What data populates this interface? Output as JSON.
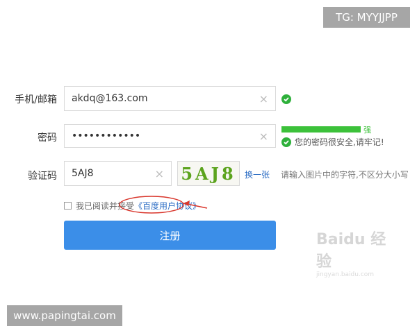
{
  "watermarks": {
    "top_right": "TG: MYYJJPP",
    "bottom_left": "www.papingtai.com",
    "baidu_logo": "Baidu 经验",
    "baidu_sub": "jingyan.baidu.com"
  },
  "form": {
    "email": {
      "label": "手机/邮箱",
      "value": "akdq@163.com",
      "clear_icon": "×"
    },
    "password": {
      "label": "密码",
      "value": "••••••••••••",
      "clear_icon": "×",
      "strength_label": "强",
      "message": "您的密码很安全,请牢记!"
    },
    "captcha": {
      "label": "验证码",
      "value": "5AJ8",
      "clear_icon": "×",
      "image_text": "5AJ8",
      "refresh_label": "换一张",
      "hint": "请输入图片中的字符,不区分大小写"
    },
    "agreement": {
      "prefix": "我已阅读并接受",
      "link": "《百度用户协议》"
    },
    "submit_label": "注册"
  },
  "colors": {
    "accent": "#3b8ee8",
    "success": "#2eb03b",
    "link": "#2b6cc4",
    "annotation": "#d9362c"
  },
  "icons": {
    "ok": "checkmark-circle-icon",
    "clear": "clear-x-icon"
  }
}
